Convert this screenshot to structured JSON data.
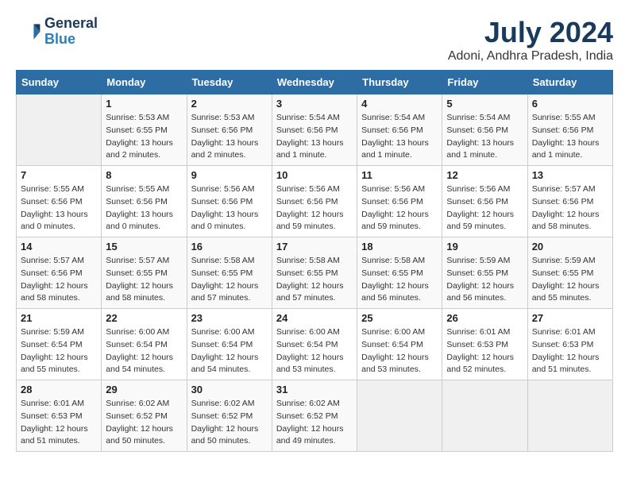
{
  "header": {
    "logo_line1": "General",
    "logo_line2": "Blue",
    "month": "July 2024",
    "location": "Adoni, Andhra Pradesh, India"
  },
  "weekdays": [
    "Sunday",
    "Monday",
    "Tuesday",
    "Wednesday",
    "Thursday",
    "Friday",
    "Saturday"
  ],
  "weeks": [
    [
      {
        "day": "",
        "info": ""
      },
      {
        "day": "1",
        "info": "Sunrise: 5:53 AM\nSunset: 6:55 PM\nDaylight: 13 hours\nand 2 minutes."
      },
      {
        "day": "2",
        "info": "Sunrise: 5:53 AM\nSunset: 6:56 PM\nDaylight: 13 hours\nand 2 minutes."
      },
      {
        "day": "3",
        "info": "Sunrise: 5:54 AM\nSunset: 6:56 PM\nDaylight: 13 hours\nand 1 minute."
      },
      {
        "day": "4",
        "info": "Sunrise: 5:54 AM\nSunset: 6:56 PM\nDaylight: 13 hours\nand 1 minute."
      },
      {
        "day": "5",
        "info": "Sunrise: 5:54 AM\nSunset: 6:56 PM\nDaylight: 13 hours\nand 1 minute."
      },
      {
        "day": "6",
        "info": "Sunrise: 5:55 AM\nSunset: 6:56 PM\nDaylight: 13 hours\nand 1 minute."
      }
    ],
    [
      {
        "day": "7",
        "info": "Sunrise: 5:55 AM\nSunset: 6:56 PM\nDaylight: 13 hours\nand 0 minutes."
      },
      {
        "day": "8",
        "info": "Sunrise: 5:55 AM\nSunset: 6:56 PM\nDaylight: 13 hours\nand 0 minutes."
      },
      {
        "day": "9",
        "info": "Sunrise: 5:56 AM\nSunset: 6:56 PM\nDaylight: 13 hours\nand 0 minutes."
      },
      {
        "day": "10",
        "info": "Sunrise: 5:56 AM\nSunset: 6:56 PM\nDaylight: 12 hours\nand 59 minutes."
      },
      {
        "day": "11",
        "info": "Sunrise: 5:56 AM\nSunset: 6:56 PM\nDaylight: 12 hours\nand 59 minutes."
      },
      {
        "day": "12",
        "info": "Sunrise: 5:56 AM\nSunset: 6:56 PM\nDaylight: 12 hours\nand 59 minutes."
      },
      {
        "day": "13",
        "info": "Sunrise: 5:57 AM\nSunset: 6:56 PM\nDaylight: 12 hours\nand 58 minutes."
      }
    ],
    [
      {
        "day": "14",
        "info": "Sunrise: 5:57 AM\nSunset: 6:56 PM\nDaylight: 12 hours\nand 58 minutes."
      },
      {
        "day": "15",
        "info": "Sunrise: 5:57 AM\nSunset: 6:55 PM\nDaylight: 12 hours\nand 58 minutes."
      },
      {
        "day": "16",
        "info": "Sunrise: 5:58 AM\nSunset: 6:55 PM\nDaylight: 12 hours\nand 57 minutes."
      },
      {
        "day": "17",
        "info": "Sunrise: 5:58 AM\nSunset: 6:55 PM\nDaylight: 12 hours\nand 57 minutes."
      },
      {
        "day": "18",
        "info": "Sunrise: 5:58 AM\nSunset: 6:55 PM\nDaylight: 12 hours\nand 56 minutes."
      },
      {
        "day": "19",
        "info": "Sunrise: 5:59 AM\nSunset: 6:55 PM\nDaylight: 12 hours\nand 56 minutes."
      },
      {
        "day": "20",
        "info": "Sunrise: 5:59 AM\nSunset: 6:55 PM\nDaylight: 12 hours\nand 55 minutes."
      }
    ],
    [
      {
        "day": "21",
        "info": "Sunrise: 5:59 AM\nSunset: 6:54 PM\nDaylight: 12 hours\nand 55 minutes."
      },
      {
        "day": "22",
        "info": "Sunrise: 6:00 AM\nSunset: 6:54 PM\nDaylight: 12 hours\nand 54 minutes."
      },
      {
        "day": "23",
        "info": "Sunrise: 6:00 AM\nSunset: 6:54 PM\nDaylight: 12 hours\nand 54 minutes."
      },
      {
        "day": "24",
        "info": "Sunrise: 6:00 AM\nSunset: 6:54 PM\nDaylight: 12 hours\nand 53 minutes."
      },
      {
        "day": "25",
        "info": "Sunrise: 6:00 AM\nSunset: 6:54 PM\nDaylight: 12 hours\nand 53 minutes."
      },
      {
        "day": "26",
        "info": "Sunrise: 6:01 AM\nSunset: 6:53 PM\nDaylight: 12 hours\nand 52 minutes."
      },
      {
        "day": "27",
        "info": "Sunrise: 6:01 AM\nSunset: 6:53 PM\nDaylight: 12 hours\nand 51 minutes."
      }
    ],
    [
      {
        "day": "28",
        "info": "Sunrise: 6:01 AM\nSunset: 6:53 PM\nDaylight: 12 hours\nand 51 minutes."
      },
      {
        "day": "29",
        "info": "Sunrise: 6:02 AM\nSunset: 6:52 PM\nDaylight: 12 hours\nand 50 minutes."
      },
      {
        "day": "30",
        "info": "Sunrise: 6:02 AM\nSunset: 6:52 PM\nDaylight: 12 hours\nand 50 minutes."
      },
      {
        "day": "31",
        "info": "Sunrise: 6:02 AM\nSunset: 6:52 PM\nDaylight: 12 hours\nand 49 minutes."
      },
      {
        "day": "",
        "info": ""
      },
      {
        "day": "",
        "info": ""
      },
      {
        "day": "",
        "info": ""
      }
    ]
  ]
}
